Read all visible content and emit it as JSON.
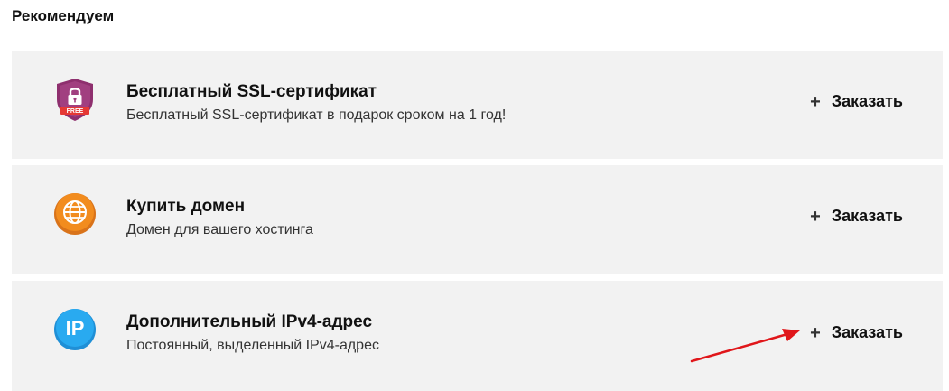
{
  "section": {
    "title": "Рекомендуем"
  },
  "cards": [
    {
      "title": "Бесплатный SSL-сертификат",
      "description": "Бесплатный SSL-сертификат в подарок сроком на 1 год!",
      "icon": "ssl-shield-free-icon",
      "badge": "FREE",
      "order_label": "Заказать"
    },
    {
      "title": "Купить домен",
      "description": "Домен для вашего хостинга",
      "icon": "globe-icon",
      "order_label": "Заказать"
    },
    {
      "title": "Дополнительный IPv4-адрес",
      "description": "Постоянный, выделенный IPv4-адрес",
      "icon": "ip-icon",
      "icon_text": "IP",
      "order_label": "Заказать"
    }
  ],
  "plus_symbol": "+",
  "colors": {
    "card_bg": "#f2f2f2",
    "ssl_shield": "#8e2f6e",
    "free_badge": "#e53935",
    "globe": "#f28c1e",
    "ip": "#29aaf0",
    "annotation_arrow": "#e0161a"
  }
}
